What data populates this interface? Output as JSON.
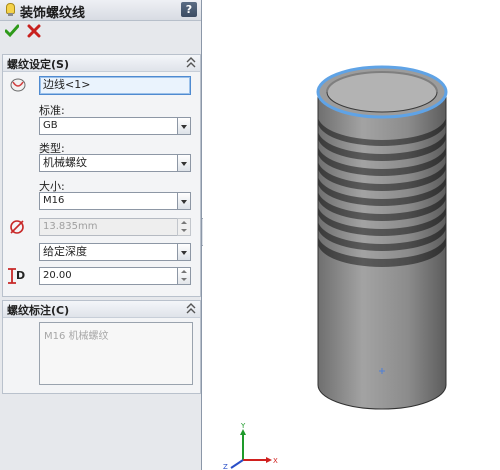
{
  "panel": {
    "title": "装饰螺纹线",
    "help_label": "?"
  },
  "colors": {
    "ok_green": "#2f9a1a",
    "cancel_red": "#c8201e",
    "selection_blue": "#4f8ad0",
    "edge_highlight": "#5fa3e6"
  },
  "thread_settings": {
    "title": "螺纹设定(S)",
    "edge_field": "边线<1>",
    "standard_label": "标准:",
    "standard_value": "GB",
    "type_label": "类型:",
    "type_value": "机械螺纹",
    "size_label": "大小:",
    "size_value": "M16",
    "diameter_value": "13.835mm",
    "end_condition_value": "给定深度",
    "depth_letter": "D",
    "depth_value": "20.00"
  },
  "thread_callout": {
    "title": "螺纹标注(C)",
    "callout_text": "M16 机械螺纹"
  },
  "triad": {
    "x_label": "X",
    "y_label": "Y",
    "z_label": "Z"
  }
}
